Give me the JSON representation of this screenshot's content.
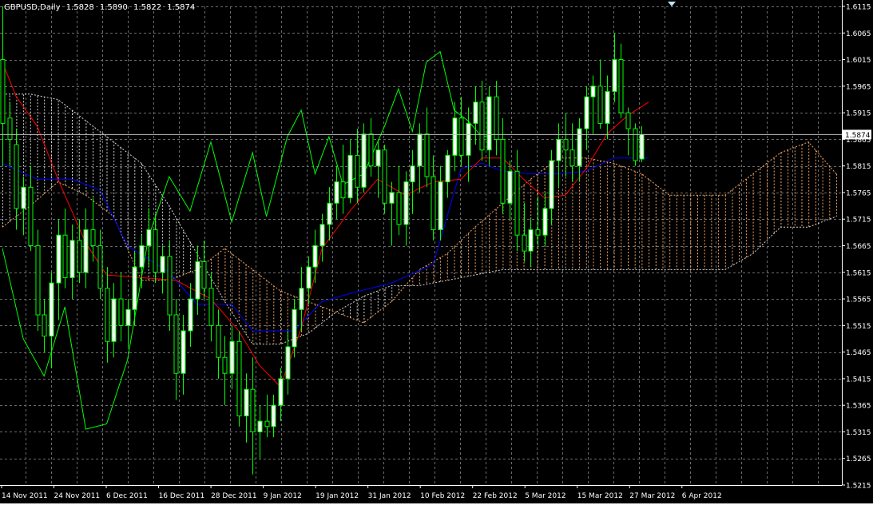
{
  "window": {
    "symbol": "GBPUSD,Daily",
    "open": "1.5828",
    "high": "1.5890",
    "low": "1.5822",
    "close": "1.5874"
  },
  "colors": {
    "background": "#000000",
    "grid": "#6b6b6b",
    "axis_text": "#ffffff",
    "candle_bull_body": "#ffffff",
    "candle_bear_body": "#000000",
    "candle_outline": "#00ff00",
    "tenkan_sen": "#ff0000",
    "kijun_sen": "#0000ff",
    "chikou_span": "#00ff00",
    "senkou_span_a_cloud": "#f4a460",
    "senkou_span_b_cloud": "#d8d8d8",
    "price_label_bg": "#ffffff"
  },
  "chart_data": {
    "type": "candlestick",
    "ylim": [
      1.5215,
      1.6115
    ],
    "y_ticks": [
      "1.6115",
      "1.6065",
      "1.6015",
      "1.5965",
      "1.5915",
      "1.5865",
      "1.5815",
      "1.5765",
      "1.5715",
      "1.5665",
      "1.5615",
      "1.5565",
      "1.5515",
      "1.5465",
      "1.5415",
      "1.5365",
      "1.5315",
      "1.5265",
      "1.5215"
    ],
    "x_labels": [
      "14 Nov 2011",
      "24 Nov 2011",
      "6 Dec 2011",
      "16 Dec 2011",
      "28 Dec 2011",
      "9 Jan 2012",
      "19 Jan 2012",
      "31 Jan 2012",
      "10 Feb 2012",
      "22 Feb 2012",
      "5 Mar 2012",
      "15 Mar 2012",
      "27 Mar 2012",
      "6 Apr 2012"
    ],
    "current_price": "1.5874",
    "grid": true,
    "candles": [
      {
        "o": 1.6015,
        "h": 1.6115,
        "l": 1.5815,
        "c": 1.5895
      },
      {
        "o": 1.5905,
        "h": 1.5935,
        "l": 1.5815,
        "c": 1.5865
      },
      {
        "o": 1.5855,
        "h": 1.5885,
        "l": 1.5695,
        "c": 1.5735
      },
      {
        "o": 1.5735,
        "h": 1.5795,
        "l": 1.5685,
        "c": 1.5775
      },
      {
        "o": 1.5775,
        "h": 1.5815,
        "l": 1.5655,
        "c": 1.5665
      },
      {
        "o": 1.5665,
        "h": 1.5695,
        "l": 1.5505,
        "c": 1.5535
      },
      {
        "o": 1.5535,
        "h": 1.5565,
        "l": 1.5465,
        "c": 1.5495
      },
      {
        "o": 1.5495,
        "h": 1.5615,
        "l": 1.5435,
        "c": 1.5595
      },
      {
        "o": 1.5595,
        "h": 1.5715,
        "l": 1.5525,
        "c": 1.5685
      },
      {
        "o": 1.5685,
        "h": 1.5735,
        "l": 1.5585,
        "c": 1.5605
      },
      {
        "o": 1.5605,
        "h": 1.5705,
        "l": 1.5565,
        "c": 1.5675
      },
      {
        "o": 1.5675,
        "h": 1.5715,
        "l": 1.5595,
        "c": 1.5615
      },
      {
        "o": 1.5615,
        "h": 1.5735,
        "l": 1.5585,
        "c": 1.5695
      },
      {
        "o": 1.5695,
        "h": 1.5755,
        "l": 1.5635,
        "c": 1.5665
      },
      {
        "o": 1.5665,
        "h": 1.5695,
        "l": 1.5565,
        "c": 1.5585
      },
      {
        "o": 1.5585,
        "h": 1.5625,
        "l": 1.5445,
        "c": 1.5485
      },
      {
        "o": 1.5485,
        "h": 1.5595,
        "l": 1.5455,
        "c": 1.5565
      },
      {
        "o": 1.5565,
        "h": 1.5615,
        "l": 1.5485,
        "c": 1.5515
      },
      {
        "o": 1.5515,
        "h": 1.5565,
        "l": 1.5475,
        "c": 1.5545
      },
      {
        "o": 1.5545,
        "h": 1.5655,
        "l": 1.5515,
        "c": 1.5625
      },
      {
        "o": 1.5625,
        "h": 1.5685,
        "l": 1.5585,
        "c": 1.5665
      },
      {
        "o": 1.5665,
        "h": 1.5735,
        "l": 1.5625,
        "c": 1.5695
      },
      {
        "o": 1.5695,
        "h": 1.5725,
        "l": 1.5595,
        "c": 1.5615
      },
      {
        "o": 1.5615,
        "h": 1.5665,
        "l": 1.5575,
        "c": 1.5645
      },
      {
        "o": 1.5645,
        "h": 1.5675,
        "l": 1.5505,
        "c": 1.5535
      },
      {
        "o": 1.5535,
        "h": 1.5565,
        "l": 1.5375,
        "c": 1.5425
      },
      {
        "o": 1.5425,
        "h": 1.5535,
        "l": 1.5385,
        "c": 1.5505
      },
      {
        "o": 1.5505,
        "h": 1.5595,
        "l": 1.5475,
        "c": 1.5565
      },
      {
        "o": 1.5565,
        "h": 1.5665,
        "l": 1.5535,
        "c": 1.5635
      },
      {
        "o": 1.5635,
        "h": 1.5675,
        "l": 1.5565,
        "c": 1.5585
      },
      {
        "o": 1.5585,
        "h": 1.5615,
        "l": 1.5485,
        "c": 1.5515
      },
      {
        "o": 1.5515,
        "h": 1.5545,
        "l": 1.5415,
        "c": 1.5455
      },
      {
        "o": 1.5455,
        "h": 1.5495,
        "l": 1.5365,
        "c": 1.5425
      },
      {
        "o": 1.5425,
        "h": 1.5515,
        "l": 1.5395,
        "c": 1.5485
      },
      {
        "o": 1.5485,
        "h": 1.5505,
        "l": 1.5325,
        "c": 1.5345
      },
      {
        "o": 1.5345,
        "h": 1.5425,
        "l": 1.5295,
        "c": 1.5395
      },
      {
        "o": 1.5395,
        "h": 1.5455,
        "l": 1.5235,
        "c": 1.5315
      },
      {
        "o": 1.5315,
        "h": 1.5365,
        "l": 1.5265,
        "c": 1.5335
      },
      {
        "o": 1.5335,
        "h": 1.5385,
        "l": 1.5305,
        "c": 1.5325
      },
      {
        "o": 1.5325,
        "h": 1.5385,
        "l": 1.5305,
        "c": 1.5365
      },
      {
        "o": 1.5365,
        "h": 1.5435,
        "l": 1.5335,
        "c": 1.5415
      },
      {
        "o": 1.5415,
        "h": 1.5505,
        "l": 1.5385,
        "c": 1.5475
      },
      {
        "o": 1.5475,
        "h": 1.5565,
        "l": 1.5455,
        "c": 1.5545
      },
      {
        "o": 1.5545,
        "h": 1.5625,
        "l": 1.5505,
        "c": 1.5585
      },
      {
        "o": 1.5585,
        "h": 1.5645,
        "l": 1.5555,
        "c": 1.5625
      },
      {
        "o": 1.5625,
        "h": 1.5695,
        "l": 1.5595,
        "c": 1.5665
      },
      {
        "o": 1.5665,
        "h": 1.5725,
        "l": 1.5635,
        "c": 1.5705
      },
      {
        "o": 1.5705,
        "h": 1.5775,
        "l": 1.5675,
        "c": 1.5745
      },
      {
        "o": 1.5745,
        "h": 1.5815,
        "l": 1.5715,
        "c": 1.5785
      },
      {
        "o": 1.5785,
        "h": 1.5855,
        "l": 1.5725,
        "c": 1.5755
      },
      {
        "o": 1.5755,
        "h": 1.5865,
        "l": 1.5745,
        "c": 1.5835
      },
      {
        "o": 1.5835,
        "h": 1.5885,
        "l": 1.5745,
        "c": 1.5775
      },
      {
        "o": 1.5775,
        "h": 1.5895,
        "l": 1.5765,
        "c": 1.5875
      },
      {
        "o": 1.5875,
        "h": 1.5905,
        "l": 1.5795,
        "c": 1.5815
      },
      {
        "o": 1.5815,
        "h": 1.5865,
        "l": 1.5755,
        "c": 1.5845
      },
      {
        "o": 1.5845,
        "h": 1.5855,
        "l": 1.5725,
        "c": 1.5745
      },
      {
        "o": 1.5745,
        "h": 1.5785,
        "l": 1.5665,
        "c": 1.5765
      },
      {
        "o": 1.5765,
        "h": 1.5815,
        "l": 1.5685,
        "c": 1.5705
      },
      {
        "o": 1.5705,
        "h": 1.5805,
        "l": 1.5665,
        "c": 1.5785
      },
      {
        "o": 1.5785,
        "h": 1.5845,
        "l": 1.5725,
        "c": 1.5815
      },
      {
        "o": 1.5815,
        "h": 1.5895,
        "l": 1.5765,
        "c": 1.5875
      },
      {
        "o": 1.5875,
        "h": 1.5925,
        "l": 1.5775,
        "c": 1.5795
      },
      {
        "o": 1.5795,
        "h": 1.5835,
        "l": 1.5675,
        "c": 1.5695
      },
      {
        "o": 1.5695,
        "h": 1.5815,
        "l": 1.5675,
        "c": 1.5785
      },
      {
        "o": 1.5785,
        "h": 1.5845,
        "l": 1.5755,
        "c": 1.5835
      },
      {
        "o": 1.5835,
        "h": 1.5935,
        "l": 1.5805,
        "c": 1.5905
      },
      {
        "o": 1.5905,
        "h": 1.5945,
        "l": 1.5815,
        "c": 1.5835
      },
      {
        "o": 1.5835,
        "h": 1.5925,
        "l": 1.5785,
        "c": 1.5895
      },
      {
        "o": 1.5895,
        "h": 1.5965,
        "l": 1.5855,
        "c": 1.5935
      },
      {
        "o": 1.5935,
        "h": 1.5975,
        "l": 1.5825,
        "c": 1.5845
      },
      {
        "o": 1.5845,
        "h": 1.5965,
        "l": 1.5815,
        "c": 1.5945
      },
      {
        "o": 1.5945,
        "h": 1.5975,
        "l": 1.5835,
        "c": 1.5865
      },
      {
        "o": 1.5865,
        "h": 1.5905,
        "l": 1.5725,
        "c": 1.5745
      },
      {
        "o": 1.5745,
        "h": 1.5825,
        "l": 1.5715,
        "c": 1.5805
      },
      {
        "o": 1.5805,
        "h": 1.5845,
        "l": 1.5655,
        "c": 1.5685
      },
      {
        "o": 1.5685,
        "h": 1.5745,
        "l": 1.5635,
        "c": 1.5655
      },
      {
        "o": 1.5655,
        "h": 1.5715,
        "l": 1.5625,
        "c": 1.5695
      },
      {
        "o": 1.5695,
        "h": 1.5755,
        "l": 1.5665,
        "c": 1.5685
      },
      {
        "o": 1.5685,
        "h": 1.5765,
        "l": 1.5665,
        "c": 1.5735
      },
      {
        "o": 1.5735,
        "h": 1.5845,
        "l": 1.5705,
        "c": 1.5825
      },
      {
        "o": 1.5825,
        "h": 1.5895,
        "l": 1.5775,
        "c": 1.5865
      },
      {
        "o": 1.5865,
        "h": 1.5915,
        "l": 1.5795,
        "c": 1.5845
      },
      {
        "o": 1.5845,
        "h": 1.5895,
        "l": 1.5785,
        "c": 1.5815
      },
      {
        "o": 1.5815,
        "h": 1.5905,
        "l": 1.5785,
        "c": 1.5885
      },
      {
        "o": 1.5885,
        "h": 1.5965,
        "l": 1.5845,
        "c": 1.5945
      },
      {
        "o": 1.5945,
        "h": 1.5985,
        "l": 1.5875,
        "c": 1.5965
      },
      {
        "o": 1.5965,
        "h": 1.6015,
        "l": 1.5885,
        "c": 1.5895
      },
      {
        "o": 1.5895,
        "h": 1.5985,
        "l": 1.5865,
        "c": 1.5955
      },
      {
        "o": 1.5955,
        "h": 1.6065,
        "l": 1.5935,
        "c": 1.6015
      },
      {
        "o": 1.6015,
        "h": 1.6045,
        "l": 1.5905,
        "c": 1.5915
      },
      {
        "o": 1.5915,
        "h": 1.5925,
        "l": 1.5835,
        "c": 1.5885
      },
      {
        "o": 1.5885,
        "h": 1.5895,
        "l": 1.5815,
        "c": 1.5825
      },
      {
        "o": 1.5828,
        "h": 1.589,
        "l": 1.5822,
        "c": 1.5874
      }
    ],
    "series": [
      {
        "key": "tenkan",
        "values": [
          [
            0,
            1.601
          ],
          [
            2,
            1.5945
          ],
          [
            5,
            1.589
          ],
          [
            8,
            1.579
          ],
          [
            12,
            1.567
          ],
          [
            15,
            1.561
          ],
          [
            20,
            1.5605
          ],
          [
            25,
            1.56
          ],
          [
            30,
            1.5565
          ],
          [
            34,
            1.5505
          ],
          [
            37,
            1.544
          ],
          [
            40,
            1.54
          ],
          [
            43,
            1.551
          ],
          [
            46,
            1.566
          ],
          [
            50,
            1.573
          ],
          [
            54,
            1.579
          ],
          [
            58,
            1.576
          ],
          [
            62,
            1.5785
          ],
          [
            66,
            1.579
          ],
          [
            69,
            1.583
          ],
          [
            72,
            1.583
          ],
          [
            75,
            1.579
          ],
          [
            78,
            1.5755
          ],
          [
            81,
            1.576
          ],
          [
            84,
            1.581
          ],
          [
            87,
            1.5875
          ],
          [
            90,
            1.591
          ],
          [
            93,
            1.5935
          ]
        ]
      },
      {
        "key": "kijun",
        "values": [
          [
            0,
            1.582
          ],
          [
            5,
            1.579
          ],
          [
            10,
            1.579
          ],
          [
            14,
            1.577
          ],
          [
            18,
            1.5665
          ],
          [
            24,
            1.5615
          ],
          [
            28,
            1.5555
          ],
          [
            33,
            1.5555
          ],
          [
            36,
            1.5505
          ],
          [
            42,
            1.5505
          ],
          [
            46,
            1.556
          ],
          [
            50,
            1.5575
          ],
          [
            56,
            1.5595
          ],
          [
            62,
            1.563
          ],
          [
            66,
            1.581
          ],
          [
            69,
            1.582
          ],
          [
            72,
            1.5805
          ],
          [
            76,
            1.58
          ],
          [
            80,
            1.58
          ],
          [
            84,
            1.5805
          ],
          [
            88,
            1.583
          ],
          [
            93,
            1.583
          ]
        ]
      },
      {
        "key": "chikou",
        "values": [
          [
            0,
            1.566
          ],
          [
            3,
            1.549
          ],
          [
            6,
            1.542
          ],
          [
            9,
            1.555
          ],
          [
            12,
            1.532
          ],
          [
            15,
            1.533
          ],
          [
            18,
            1.545
          ],
          [
            21,
            1.568
          ],
          [
            24,
            1.5795
          ],
          [
            27,
            1.573
          ],
          [
            30,
            1.586
          ],
          [
            33,
            1.571
          ],
          [
            36,
            1.584
          ],
          [
            38,
            1.572
          ],
          [
            41,
            1.587
          ],
          [
            43,
            1.592
          ],
          [
            45,
            1.58
          ],
          [
            47,
            1.587
          ],
          [
            49,
            1.578
          ],
          [
            52,
            1.58
          ],
          [
            55,
            1.589
          ],
          [
            57,
            1.596
          ],
          [
            59,
            1.588
          ],
          [
            61,
            1.601
          ],
          [
            63,
            1.603
          ],
          [
            65,
            1.592
          ],
          [
            67,
            1.59
          ],
          [
            69,
            1.587
          ],
          [
            71,
            1.5875
          ]
        ]
      },
      {
        "key": "span_a",
        "values": [
          [
            0,
            1.57
          ],
          [
            4,
            1.574
          ],
          [
            8,
            1.5785
          ],
          [
            12,
            1.576
          ],
          [
            16,
            1.572
          ],
          [
            20,
            1.56
          ],
          [
            24,
            1.56
          ],
          [
            28,
            1.562
          ],
          [
            32,
            1.566
          ],
          [
            36,
            1.562
          ],
          [
            40,
            1.558
          ],
          [
            44,
            1.556
          ],
          [
            48,
            1.554
          ],
          [
            52,
            1.552
          ],
          [
            56,
            1.556
          ],
          [
            60,
            1.562
          ],
          [
            64,
            1.565
          ],
          [
            68,
            1.57
          ],
          [
            72,
            1.5745
          ],
          [
            76,
            1.579
          ],
          [
            80,
            1.583
          ],
          [
            84,
            1.583
          ],
          [
            88,
            1.582
          ],
          [
            92,
            1.58
          ],
          [
            96,
            1.576
          ],
          [
            100,
            1.576
          ],
          [
            104,
            1.576
          ],
          [
            108,
            1.58
          ],
          [
            112,
            1.584
          ],
          [
            116,
            1.586
          ],
          [
            120,
            1.58
          ]
        ]
      },
      {
        "key": "span_b",
        "values": [
          [
            0,
            1.595
          ],
          [
            4,
            1.595
          ],
          [
            8,
            1.594
          ],
          [
            12,
            1.59
          ],
          [
            16,
            1.586
          ],
          [
            20,
            1.582
          ],
          [
            24,
            1.574
          ],
          [
            28,
            1.565
          ],
          [
            32,
            1.556
          ],
          [
            36,
            1.548
          ],
          [
            40,
            1.548
          ],
          [
            44,
            1.55
          ],
          [
            48,
            1.554
          ],
          [
            52,
            1.557
          ],
          [
            56,
            1.559
          ],
          [
            60,
            1.559
          ],
          [
            64,
            1.56
          ],
          [
            68,
            1.561
          ],
          [
            72,
            1.562
          ],
          [
            76,
            1.562
          ],
          [
            80,
            1.562
          ],
          [
            84,
            1.562
          ],
          [
            88,
            1.562
          ],
          [
            92,
            1.562
          ],
          [
            96,
            1.562
          ],
          [
            100,
            1.562
          ],
          [
            104,
            1.562
          ],
          [
            108,
            1.565
          ],
          [
            112,
            1.57
          ],
          [
            116,
            1.57
          ],
          [
            120,
            1.572
          ]
        ]
      }
    ]
  }
}
